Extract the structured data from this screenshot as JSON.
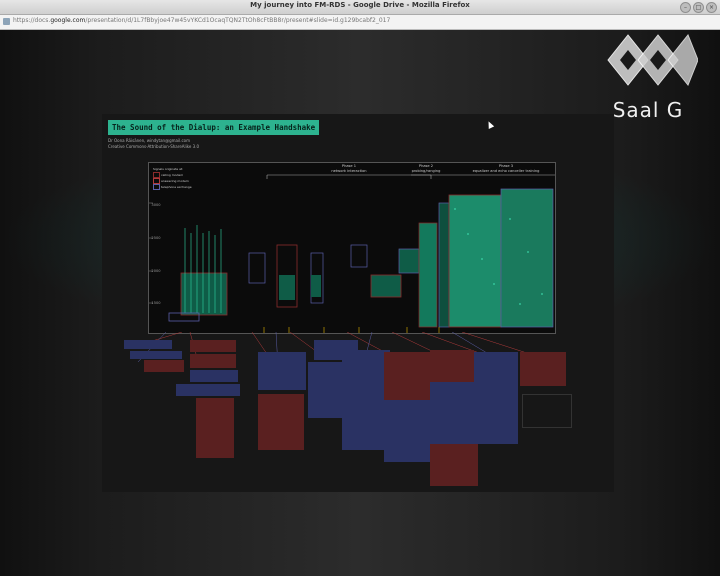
{
  "window": {
    "title": "My journey into FM-RDS - Google Drive - Mozilla Firefox",
    "url_prefix": "https://docs.",
    "url_host": "google.com",
    "url_rest": "/presentation/d/1L7fBbyjoe47w45vYKCd1OcaqTQN2TtOh8cFtBB8r/present#slide=id.g129bcabf2_017"
  },
  "overlay": {
    "brand": "Saal G"
  },
  "slide": {
    "title": "The Sound of the Dialup: an Example Handshake",
    "author_line1": "Dr Oona Räisänen, windytan@gmail.com",
    "author_line2": "Creative Commons-Attribution-ShareAlike 3.0",
    "phases": [
      {
        "label": "Phase 1",
        "sub": "network interaction"
      },
      {
        "label": "Phase 2",
        "sub": "probing/ranging"
      },
      {
        "label": "Phase 3",
        "sub": "equalizer and echo canceller training"
      }
    ],
    "legend_title": "Signals originate at:",
    "legend_items": [
      "calling modem",
      "answering modem",
      "telephone exchange"
    ],
    "y_ticks": [
      "3000",
      "2500",
      "2000",
      "1500",
      "1000"
    ]
  },
  "colors": {
    "title_bg": "#2db38f",
    "note_blue": "#2a3263",
    "note_red": "#5a2020",
    "spectrogram": "#1fae86"
  }
}
